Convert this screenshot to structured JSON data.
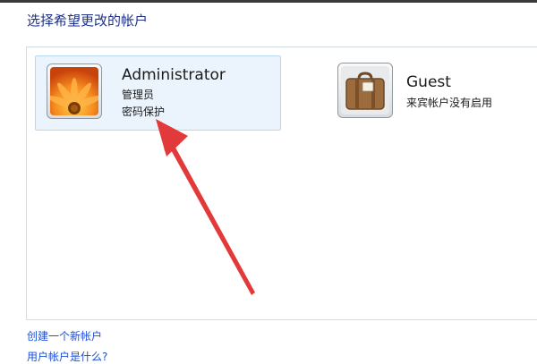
{
  "page": {
    "title": "选择希望更改的帐户"
  },
  "accounts": [
    {
      "name": "Administrator",
      "role": "管理员",
      "status": "密码保护",
      "avatar_icon": "flower-avatar-icon"
    },
    {
      "name": "Guest",
      "status": "来宾帐户没有启用",
      "avatar_icon": "suitcase-avatar-icon"
    }
  ],
  "links": {
    "create_account": "创建一个新帐户",
    "what_is_account": "用户帐户是什么?"
  },
  "colors": {
    "title": "#1e3287",
    "link": "#1e4ed8",
    "selection_bg": "#ebf4fd",
    "annotation_arrow": "#e23a3a"
  }
}
